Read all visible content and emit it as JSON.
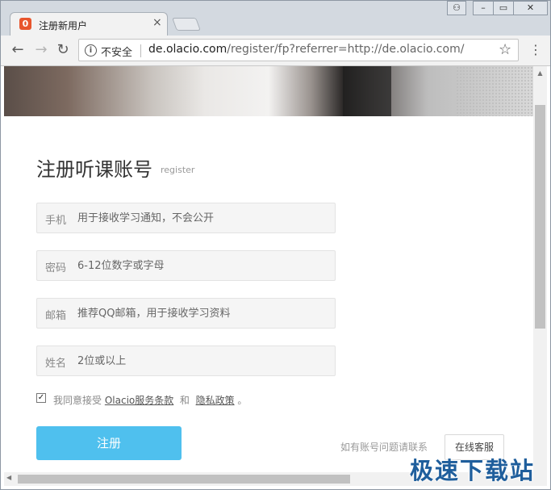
{
  "browser": {
    "tab_title": "注册新用户",
    "tab_favicon_text": "0",
    "tab_close": "×",
    "security_label": "不安全",
    "url_host": "de.olacio.com",
    "url_path": "/register/fp?referrer=http://de.olacio.com/",
    "window_buttons": {
      "user": "⚇",
      "minimize": "–",
      "maximize": "▭",
      "close": "✕"
    },
    "nav": {
      "back": "←",
      "forward": "→",
      "reload": "↻",
      "bookmark": "☆",
      "menu": "⋮"
    }
  },
  "page": {
    "title": "注册听课账号",
    "subtitle": "register",
    "fields": [
      {
        "label": "手机",
        "placeholder": "用于接收学习通知，不会公开"
      },
      {
        "label": "密码",
        "placeholder": "6-12位数字或字母"
      },
      {
        "label": "邮箱",
        "placeholder": "推荐QQ邮箱，用于接收学习资料"
      },
      {
        "label": "姓名",
        "placeholder": "2位或以上"
      }
    ],
    "agree": {
      "checked": true,
      "prefix": "我同意接受",
      "terms": "Olacio服务条款",
      "and": "和",
      "privacy": "隐私政策",
      "suffix": "。"
    },
    "submit_label": "注册",
    "help_text": "如有账号问题请联系",
    "service_button": "在线客服"
  },
  "watermark": "极速下载站",
  "colors": {
    "accent": "#4fc0ee",
    "favicon": "#e8552d"
  }
}
